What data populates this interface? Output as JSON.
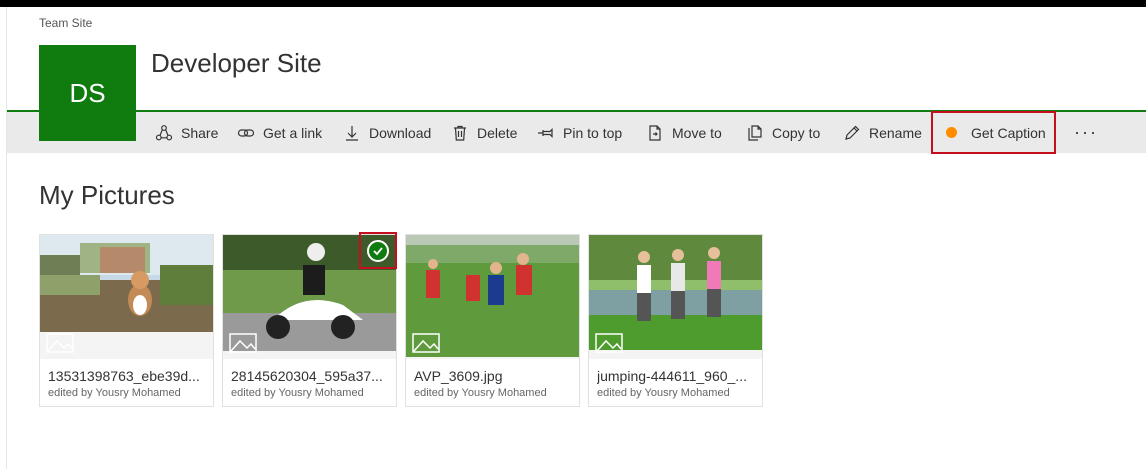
{
  "breadcrumb": "Team Site",
  "site": {
    "logo_text": "DS",
    "title": "Developer Site",
    "brand_color": "#107c10"
  },
  "commands": {
    "share": "Share",
    "get_link": "Get a link",
    "download": "Download",
    "delete": "Delete",
    "pin": "Pin to top",
    "move": "Move to",
    "copy": "Copy to",
    "rename": "Rename",
    "caption": "Get Caption",
    "more": "···"
  },
  "section_title": "My Pictures",
  "files": [
    {
      "name": "13531398763_ebe39d...",
      "edited": "edited by Yousry Mohamed",
      "icon": "image-placeholder-icon"
    },
    {
      "name": "28145620304_595a37...",
      "edited": "edited by Yousry Mohamed",
      "selected": true,
      "icon": "image-placeholder-icon"
    },
    {
      "name": "AVP_3609.jpg",
      "edited": "edited by Yousry Mohamed",
      "icon": "image-placeholder-icon"
    },
    {
      "name": "jumping-444611_960_...",
      "edited": "edited by Yousry Mohamed",
      "icon": "image-placeholder-icon"
    }
  ],
  "colors": {
    "accent": "#107c10",
    "highlight": "#c50f1f",
    "status_dot": "#ff8c00",
    "commandbar": "#eaeaea"
  }
}
